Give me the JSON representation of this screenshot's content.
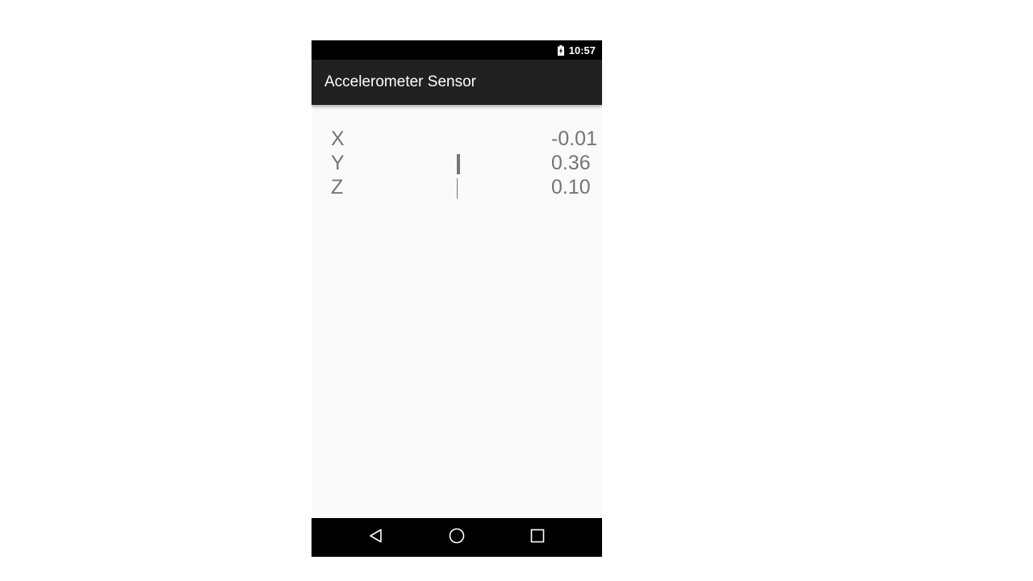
{
  "status_bar": {
    "time": "10:57",
    "battery_icon": "battery-charging-icon"
  },
  "app_bar": {
    "title": "Accelerometer Sensor"
  },
  "readings": [
    {
      "axis": "X",
      "value": "-0.01",
      "magnitude": -0.01
    },
    {
      "axis": "Y",
      "value": "0.36",
      "magnitude": 0.36
    },
    {
      "axis": "Z",
      "value": "0.10",
      "magnitude": 0.1
    }
  ],
  "nav_bar": {
    "back_icon": "back-triangle-icon",
    "home_icon": "home-circle-icon",
    "recents_icon": "recents-square-icon"
  },
  "colors": {
    "status_bar": "#000000",
    "app_bar": "#212121",
    "background": "#fafafa",
    "reading_text": "#757575",
    "nav_bar": "#000000"
  }
}
